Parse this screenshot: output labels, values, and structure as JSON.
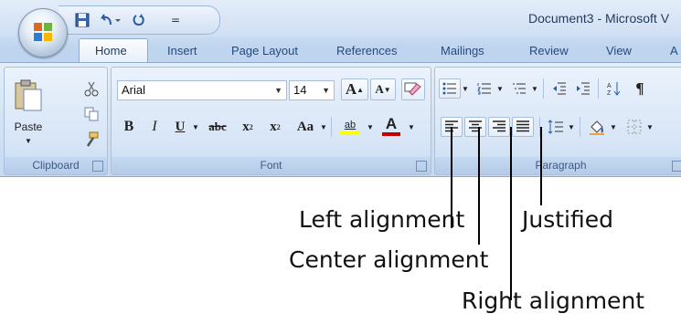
{
  "window": {
    "title": "Document3 - Microsoft V"
  },
  "tabs": [
    {
      "label": "Home",
      "active": true
    },
    {
      "label": "Insert"
    },
    {
      "label": "Page Layout"
    },
    {
      "label": "References"
    },
    {
      "label": "Mailings"
    },
    {
      "label": "Review"
    },
    {
      "label": "View"
    },
    {
      "label": "A"
    }
  ],
  "clipboard": {
    "paste_label": "Paste",
    "group_label": "Clipboard"
  },
  "font": {
    "family": "Arial",
    "size": "14",
    "group_label": "Font",
    "bold": "B",
    "italic": "I",
    "underline": "U",
    "strike": "abc",
    "subscript": "x",
    "superscript": "x",
    "change_case": "Aa",
    "grow": "A",
    "shrink": "A",
    "highlight": "ab",
    "font_color": "A"
  },
  "paragraph": {
    "group_label": "Paragraph",
    "show_marks": "¶"
  },
  "callouts": {
    "left": "Left alignment",
    "center": "Center alignment",
    "justified": "Justified",
    "right": "Right alignment"
  },
  "colors": {
    "accent": "#254a80",
    "highlight": "#ffff00",
    "font_color": "#c00000"
  }
}
